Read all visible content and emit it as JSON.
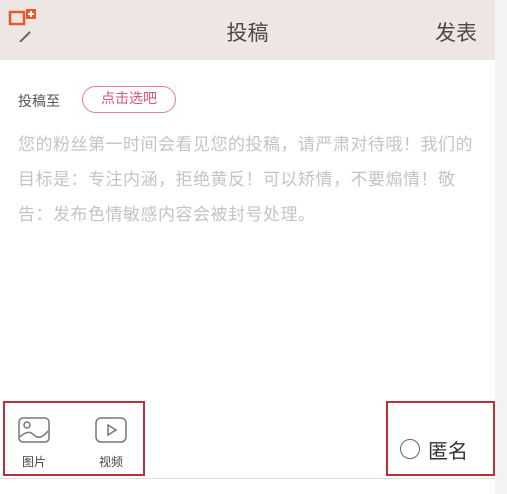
{
  "header": {
    "title": "投稿",
    "action_label": "发表"
  },
  "target": {
    "label": "投稿至",
    "select_button": "点击选吧"
  },
  "editor": {
    "placeholder": "您的粉丝第一时间会看见您的投稿，请严肃对待哦！我们的目标是：专注内涵，拒绝黄反！可以矫情，不要煽情！敬告：发布色情敏感内容会被封号处理。"
  },
  "toolbar": {
    "image_label": "图片",
    "video_label": "视频",
    "anonymous_label": "匿名"
  },
  "icons": {
    "back": "chevron-left-icon",
    "image": "image-icon",
    "video": "video-play-icon",
    "badge": "add-window-icon"
  },
  "colors": {
    "header_bg": "#ede6e3",
    "accent_pink": "#d9557a",
    "highlight_red": "#b8323a",
    "hint_gray": "#c4c4c4"
  }
}
